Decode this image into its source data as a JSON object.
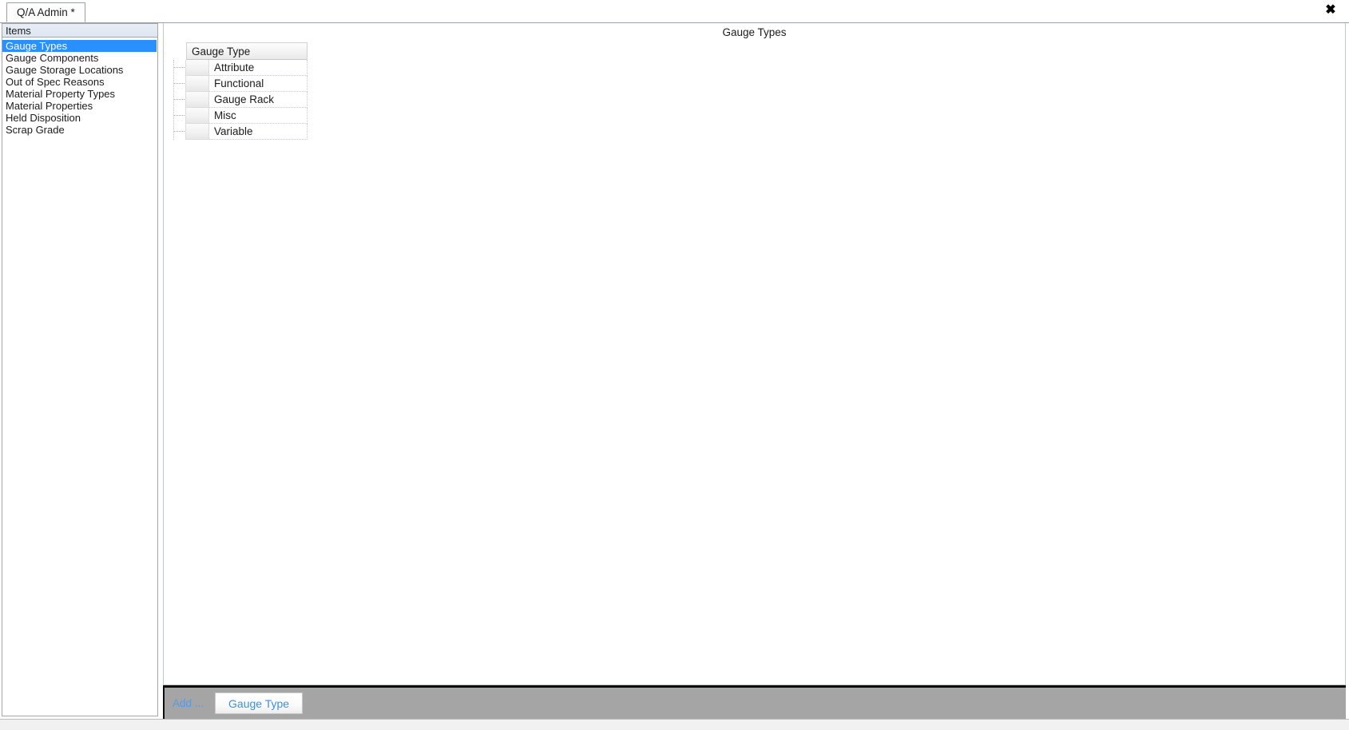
{
  "window": {
    "close_icon": "close-icon",
    "close_glyph": "✖"
  },
  "tabs": [
    {
      "label": "Q/A Admin *",
      "active": true
    }
  ],
  "sidebar": {
    "header": "Items",
    "selected_index": 0,
    "items": [
      {
        "label": "Gauge Types"
      },
      {
        "label": "Gauge Components"
      },
      {
        "label": "Gauge Storage Locations"
      },
      {
        "label": "Out of Spec Reasons"
      },
      {
        "label": "Material Property Types"
      },
      {
        "label": "Material Properties"
      },
      {
        "label": "Held Disposition"
      },
      {
        "label": "Scrap Grade"
      }
    ]
  },
  "main": {
    "title": "Gauge Types",
    "grid": {
      "columns": [
        "Gauge Type"
      ],
      "rows": [
        {
          "gauge_type": "Attribute"
        },
        {
          "gauge_type": "Functional"
        },
        {
          "gauge_type": "Gauge Rack"
        },
        {
          "gauge_type": "Misc"
        },
        {
          "gauge_type": "Variable"
        }
      ]
    }
  },
  "toolbar": {
    "add_label": "Add ...",
    "add_button_label": "Gauge Type"
  },
  "colors": {
    "selection_blue": "#2a8fff",
    "link_blue": "#4f9bf0",
    "button_text_blue": "#3a8fe8",
    "toolbar_gray": "#a5a5a5"
  }
}
